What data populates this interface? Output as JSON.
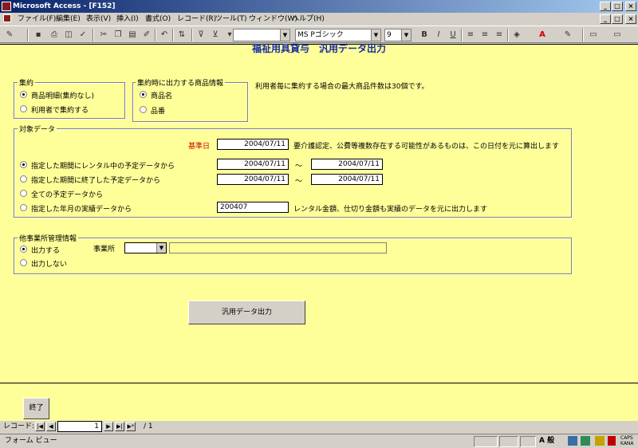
{
  "window": {
    "title": "Microsoft Access - [F152]",
    "controls": [
      "_",
      "□",
      "×"
    ],
    "doc_controls": [
      "_",
      "□",
      "×"
    ]
  },
  "menu": [
    "ファイル(F)",
    "編集(E)",
    "表示(V)",
    "挿入(I)",
    "書式(O)",
    "レコード(R)",
    "ツール(T)",
    "ウィンドウ(W)",
    "ヘルプ(H)"
  ],
  "toolbar": {
    "font_name": "MS Pゴシック",
    "font_size": "9",
    "bold": "B",
    "italic": "I",
    "underline": "U"
  },
  "form": {
    "title": "福祉用具貸与　汎用データ出力",
    "aggregate": {
      "caption": "集約",
      "options": [
        "商品明細(集約なし)",
        "利用者で集約する"
      ],
      "selected": 0
    },
    "product_info": {
      "caption": "集約時に出力する商品情報",
      "options": [
        "商品名",
        "品番"
      ],
      "selected": 0
    },
    "max_note": "利用者毎に集約する場合の最大商品件数は30個です。",
    "target": {
      "caption": "対象データ",
      "base_date_label": "基準日",
      "base_date": "2004/07/11",
      "base_note": "要介護認定、公費等複数存在する可能性があるものは、この日付を元に算出します",
      "options": [
        "指定した期間にレンタル中の予定データから",
        "指定した期間に終了した予定データから",
        "全ての予定データから",
        "指定した年月の実績データから"
      ],
      "selected": 0,
      "range1_from": "2004/07/11",
      "range1_to": "2004/07/11",
      "range2_from": "2004/07/11",
      "range2_to": "2004/07/11",
      "tilde": "～",
      "yearmonth": "200407",
      "yearmonth_note": "レンタル金額、仕切り金額も実績のデータを元に出力します"
    },
    "other_office": {
      "caption": "他事業所管理情報",
      "options": [
        "出力する",
        "出力しない"
      ],
      "selected": 0,
      "office_label": "事業所",
      "office_value": "",
      "office_name": ""
    },
    "export_button": "汎用データ出力",
    "end_button": "終了"
  },
  "record_nav": {
    "label": "レコード:",
    "current": "1",
    "total": "/ 1"
  },
  "status": {
    "text": "フォーム ビュー",
    "ime": "A 般",
    "caps": "CAPS KANA"
  }
}
